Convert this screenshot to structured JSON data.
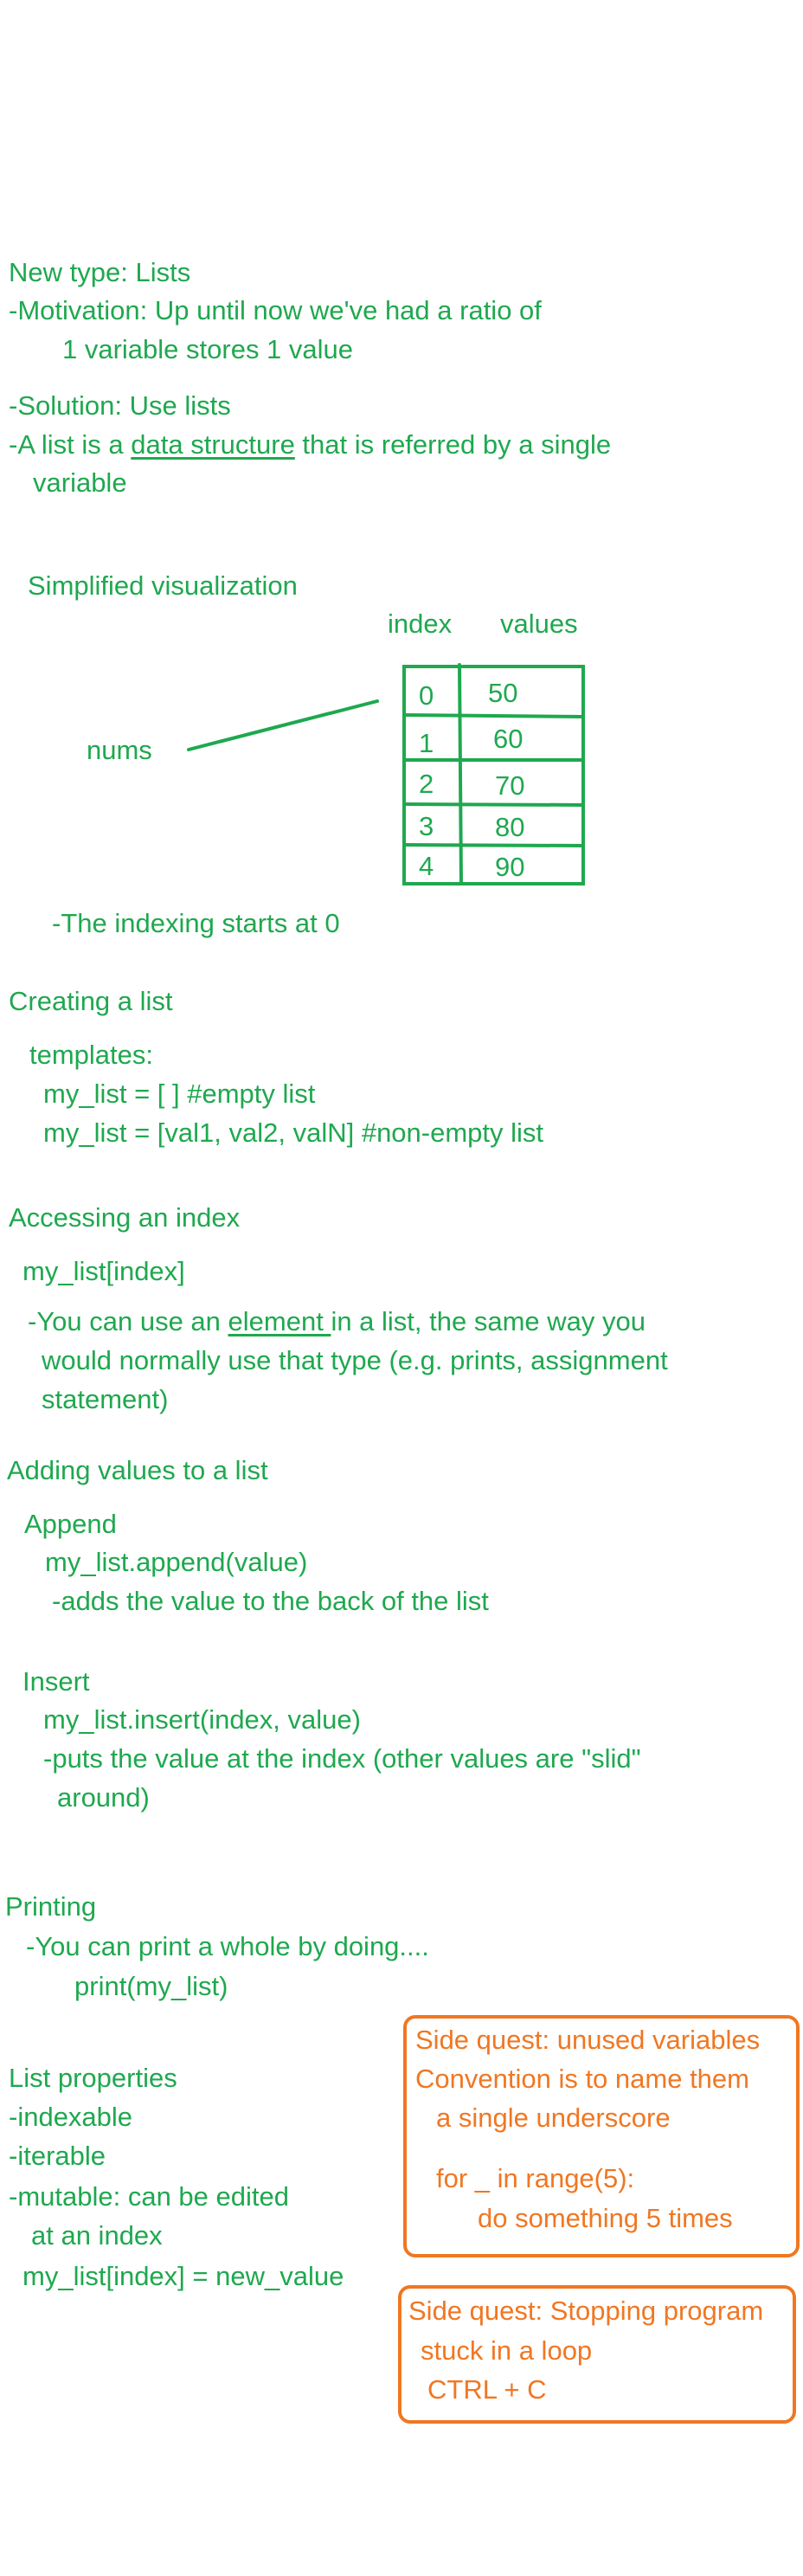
{
  "intro": {
    "title": "New type: Lists",
    "motivation_1": "-Motivation: Up until now we've had a ratio of",
    "motivation_2": "1 variable stores 1 value",
    "solution": "-Solution: Use lists",
    "def_prefix": "-A list is a ",
    "def_term": "data structure",
    "def_suffix": " that is referred by a single",
    "def_line2": "variable"
  },
  "visualization": {
    "title": "Simplified visualization",
    "index_header": "index",
    "values_header": "values",
    "var_name": "nums",
    "rows": [
      {
        "index": "0",
        "value": "50"
      },
      {
        "index": "1",
        "value": "60"
      },
      {
        "index": "2",
        "value": "70"
      },
      {
        "index": "3",
        "value": "80"
      },
      {
        "index": "4",
        "value": "90"
      }
    ],
    "note": "-The indexing starts at 0"
  },
  "creating": {
    "title": "Creating a list",
    "templates_label": "templates:",
    "empty": "my_list = [ ] #empty list",
    "non_empty": "my_list = [val1, val2, valN] #non-empty list"
  },
  "accessing": {
    "title": "Accessing an index",
    "syntax": "my_list[index]",
    "note_prefix": "-You can use an ",
    "note_term": "element ",
    "note_suffix": " in a list, the same way you",
    "note_line2": "would normally use that type (e.g. prints, assignment",
    "note_line3": "statement)"
  },
  "adding": {
    "title": "Adding values to a list",
    "append_label": "Append",
    "append_syntax": "my_list.append(value)",
    "append_note": "-adds the value to the back of the list",
    "insert_label": "Insert",
    "insert_syntax": "my_list.insert(index, value)",
    "insert_note_1": "-puts the value at the index (other values are \"slid\"",
    "insert_note_2": "around)"
  },
  "printing": {
    "title": "Printing",
    "note": "-You can print a whole by doing....",
    "code": "print(my_list)"
  },
  "properties": {
    "title": "List properties",
    "items": [
      "-indexable",
      "-iterable",
      "-mutable: can be edited"
    ],
    "mutable_line2": "at an index",
    "example": "my_list[index] = new_value"
  },
  "side_quest_1": {
    "title": "Side quest: unused variables",
    "line2": "Convention is to name them",
    "line3": "a single underscore",
    "code1": "for _ in range(5):",
    "code2": "do something 5 times"
  },
  "side_quest_2": {
    "title": "Side quest: Stopping program",
    "line2": "stuck in a loop",
    "line3": "CTRL + C"
  },
  "colors": {
    "ink_green": "#1fa84f",
    "ink_orange": "#f07722",
    "background": "#ffffff"
  }
}
